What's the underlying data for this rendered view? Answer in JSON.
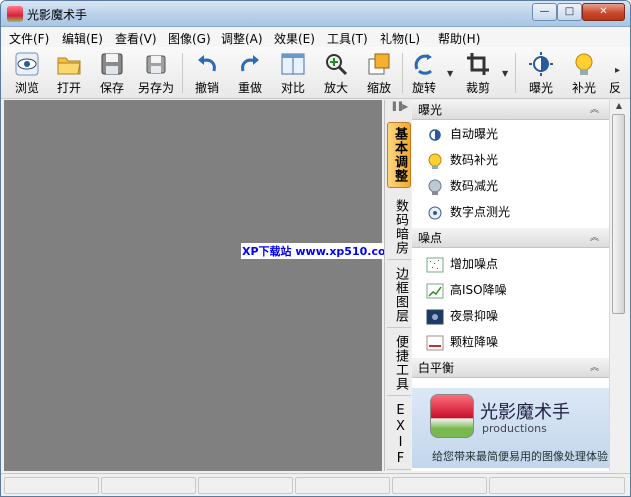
{
  "window": {
    "title": "光影魔术手",
    "min": "—",
    "max": "□",
    "close": "✕"
  },
  "menu": [
    "文件(F)",
    "编辑(E)",
    "查看(V)",
    "图像(G)",
    "调整(A)",
    "效果(E)",
    "工具(T)",
    "礼物(L)",
    "帮助(H)"
  ],
  "toolbar": [
    "浏览",
    "打开",
    "保存",
    "另存为",
    "撤销",
    "重做",
    "对比",
    "放大",
    "缩放",
    "旋转",
    "裁剪",
    "曝光",
    "补光",
    "反"
  ],
  "watermark": "XP下载站 www.xp510.com",
  "side_tabs": {
    "basic": "基本调整",
    "darkroom": "数码暗房",
    "frame": "边框图层",
    "tools": "便捷工具",
    "exif": "EXIF"
  },
  "sections": [
    {
      "title": "曝光",
      "items": [
        "自动曝光",
        "数码补光",
        "数码减光",
        "数字点测光"
      ]
    },
    {
      "title": "噪点",
      "items": [
        "增加噪点",
        "高ISO降噪",
        "夜景抑噪",
        "颗粒降噪"
      ]
    },
    {
      "title": "白平衡",
      "items": []
    }
  ],
  "promo": {
    "name": "光影魔术手",
    "sub": "productions",
    "slogan": "给您带来最简便易用的图像处理体验"
  },
  "colors": {
    "accent": "#f0a830",
    "canvas": "#808080",
    "watermark": "#0000ff"
  }
}
